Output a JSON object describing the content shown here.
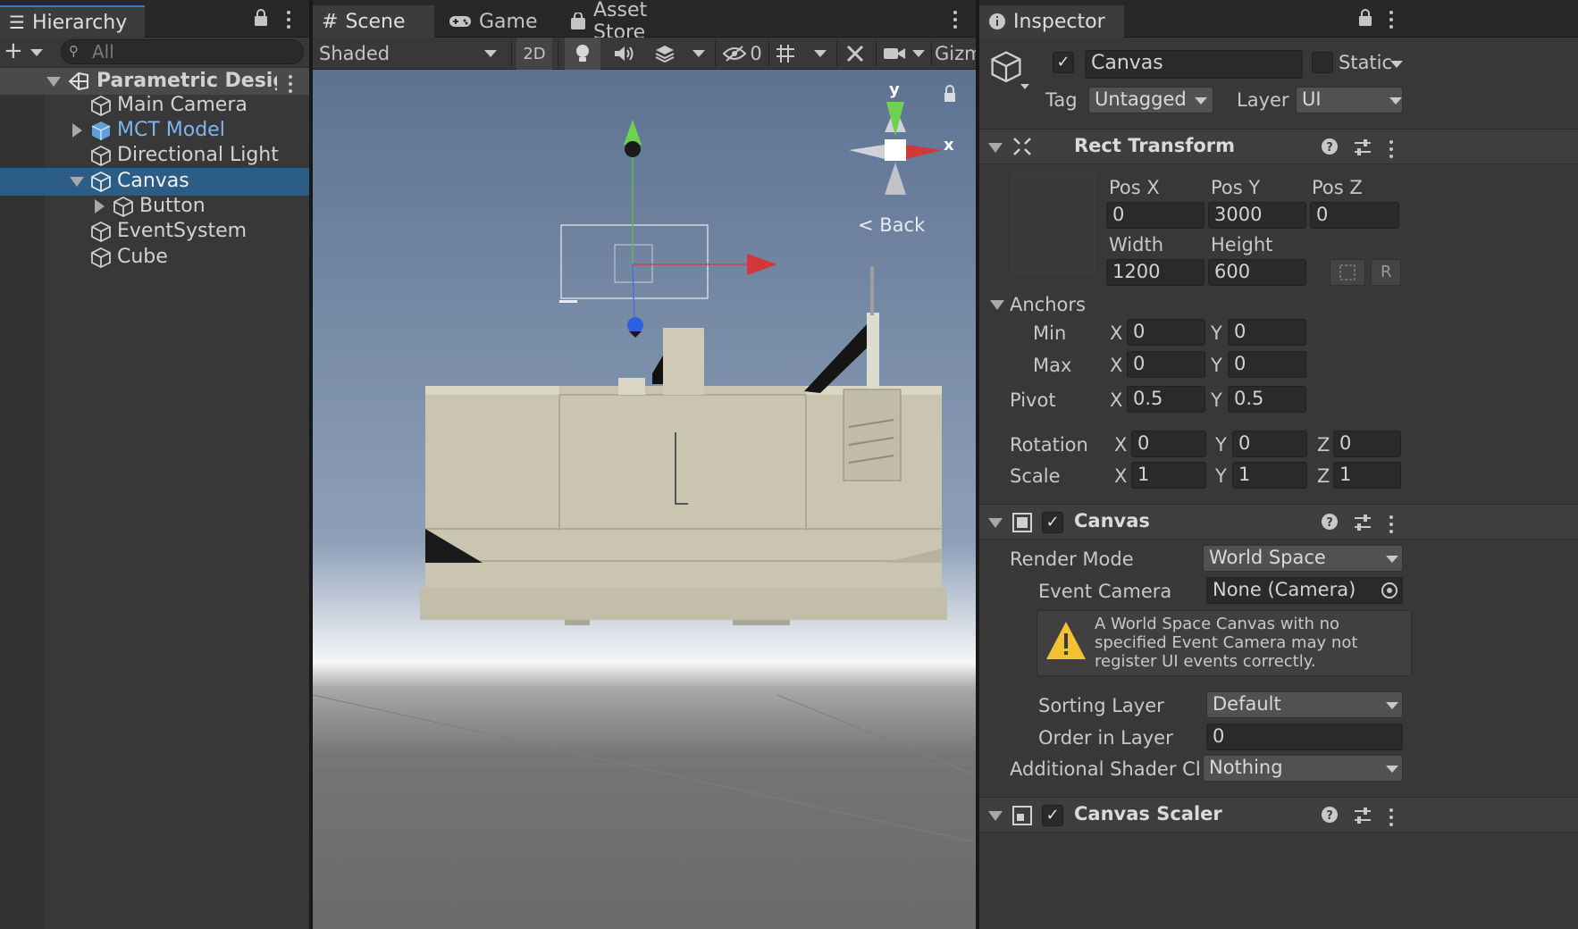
{
  "hierarchy": {
    "tab_label": "Hierarchy",
    "search_placeholder": "All",
    "scene_name": "Parametric Design*",
    "items": [
      {
        "label": "Main Camera"
      },
      {
        "label": "MCT Model"
      },
      {
        "label": "Directional Light"
      },
      {
        "label": "Canvas"
      },
      {
        "label": "Button"
      },
      {
        "label": "EventSystem"
      },
      {
        "label": "Cube"
      }
    ]
  },
  "scene_view": {
    "tabs": [
      {
        "label": "Scene"
      },
      {
        "label": "Game"
      },
      {
        "label": "Asset Store"
      }
    ],
    "shading_mode": "Shaded",
    "mode_2d": "2D",
    "hidden_count": "0",
    "gizmos_label": "Gizmos",
    "gizmo_y": "y",
    "gizmo_x": "x",
    "back_label": "< Back",
    "colors": {
      "sky": "#6f84a2",
      "ground": "#6e6d6d",
      "model": "#c9c5b0"
    }
  },
  "inspector": {
    "tab_label": "Inspector",
    "object_name": "Canvas",
    "static_label": "Static",
    "tag_label": "Tag",
    "tag_value": "Untagged",
    "layer_label": "Layer",
    "layer_value": "UI",
    "rect_transform": {
      "title": "Rect Transform",
      "pos_x_label": "Pos X",
      "pos_y_label": "Pos Y",
      "pos_z_label": "Pos Z",
      "pos_x": "0",
      "pos_y": "3000",
      "pos_z": "0",
      "width_label": "Width",
      "height_label": "Height",
      "width": "1200",
      "height": "600",
      "r_label": "R",
      "anchors_label": "Anchors",
      "min_label": "Min",
      "max_label": "Max",
      "anchor_min_x": "0",
      "anchor_min_y": "0",
      "anchor_max_x": "0",
      "anchor_max_y": "0",
      "pivot_label": "Pivot",
      "pivot_x": "0.5",
      "pivot_y": "0.5",
      "rotation_label": "Rotation",
      "rot_x": "0",
      "rot_y": "0",
      "rot_z": "0",
      "scale_label": "Scale",
      "scale_x": "1",
      "scale_y": "1",
      "scale_z": "1",
      "x": "X",
      "y": "Y",
      "z": "Z"
    },
    "canvas": {
      "title": "Canvas",
      "render_mode_label": "Render Mode",
      "render_mode": "World Space",
      "event_camera_label": "Event Camera",
      "event_camera": "None (Camera)",
      "warning": "A World Space Canvas with no specified Event Camera may not register UI events correctly.",
      "sorting_layer_label": "Sorting Layer",
      "sorting_layer": "Default",
      "order_label": "Order in Layer",
      "order": "0",
      "shader_label": "Additional Shader Ch",
      "shader_value": "Nothing"
    },
    "canvas_scaler": {
      "title": "Canvas Scaler"
    }
  }
}
